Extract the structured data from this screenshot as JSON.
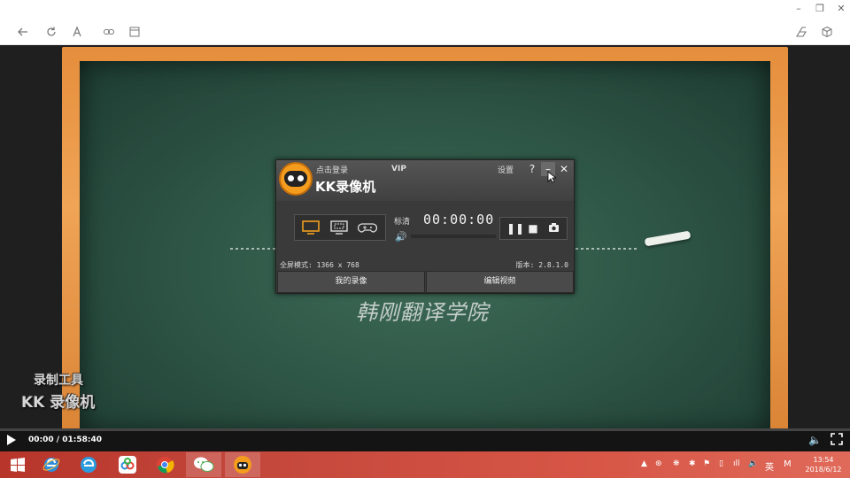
{
  "browser": {
    "window_controls": [
      "–",
      "❐",
      "✕"
    ],
    "icons": [
      "back-icon",
      "refresh-icon",
      "text-icon",
      "link-icon",
      "reader-icon",
      "share-icon",
      "extensions-icon"
    ]
  },
  "video": {
    "board_caption": "韩刚翻译学院",
    "watermark_line1": "录制工具",
    "watermark_line2": "KK 录像机"
  },
  "recorder": {
    "login": "点击登录",
    "vip": "VIP",
    "title": "KK录像机",
    "settings": "设置",
    "help": "?",
    "minimize": "–",
    "close": "✕",
    "quality": "标清",
    "timer": "00:00:00",
    "mode_text": "全屏模式: 1366 x 768",
    "version": "版本: 2.8.1.0",
    "tab_my_videos": "我的录像",
    "tab_edit": "编辑视频",
    "accent_color": "#f0a020"
  },
  "player": {
    "time": "00:00 / 01:58:40",
    "progress": 0.0
  },
  "taskbar": {
    "apps": [
      "windows-start-icon",
      "ie-icon",
      "edge-icon",
      "baidu-netdisk-icon",
      "chrome-icon",
      "wechat-icon",
      "kk-recorder-icon"
    ],
    "ime": "英",
    "time": "13:54",
    "date": "2018/6/12"
  }
}
